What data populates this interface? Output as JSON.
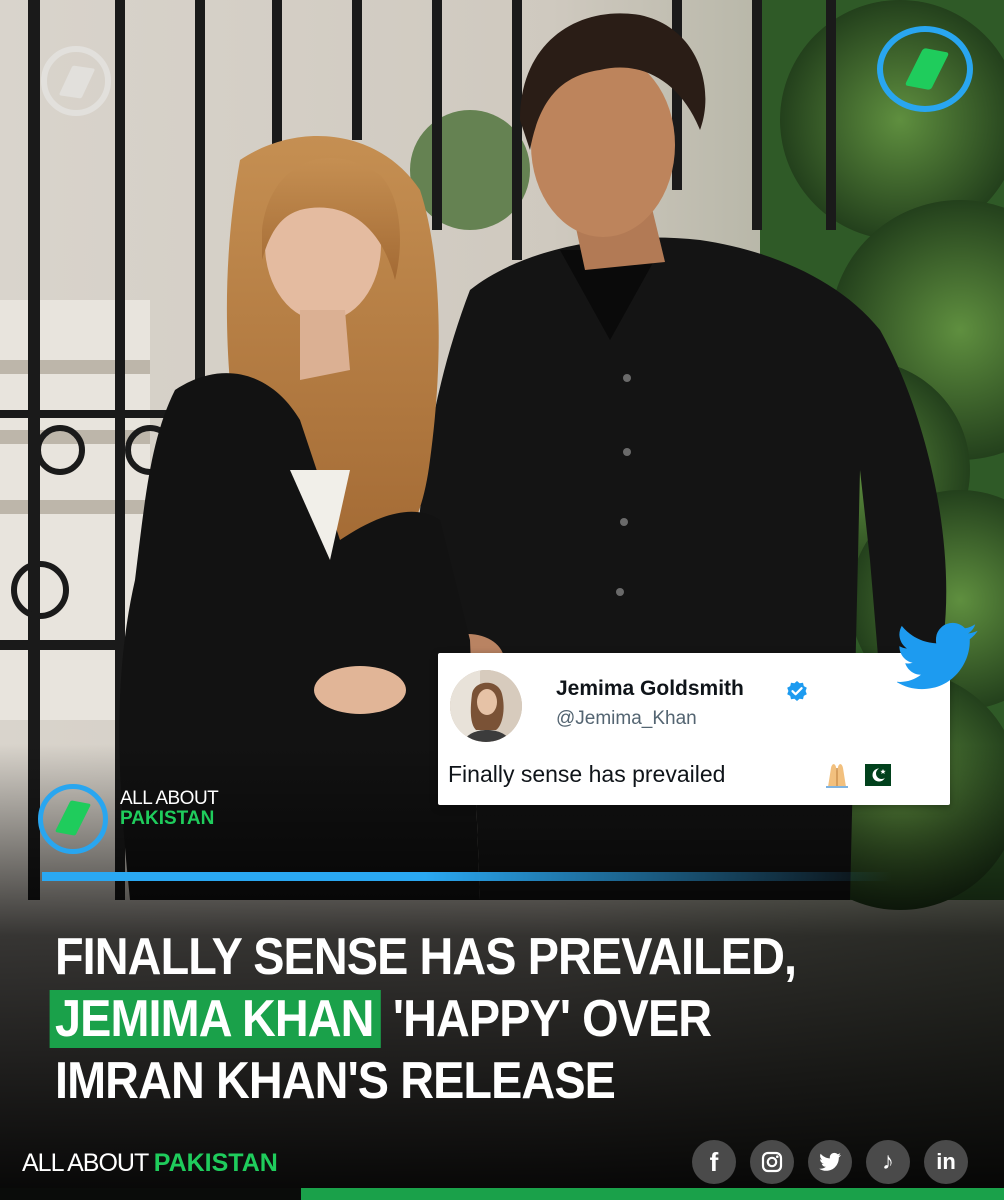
{
  "colors": {
    "accent_blue": "#29a6f0",
    "accent_green": "#1fcc5c",
    "highlight_green": "#1aa14a",
    "background": "#0a0c0a"
  },
  "tweet": {
    "name": "Jemima Goldsmith",
    "handle": "@Jemima_Khan",
    "text": "Finally sense has prevailed",
    "emoji": [
      "folded-hands-emoji",
      "pakistan-flag-emoji"
    ],
    "verified_icon": "verified-badge-icon"
  },
  "brand_badge": {
    "line1": "ALL ABOUT",
    "line2": "PAKISTAN"
  },
  "headline": {
    "line1": "FINALLY SENSE HAS PREVAILED,",
    "line2_highlight": "JEMIMA KHAN",
    "line2_rest": " 'HAPPY' OVER",
    "line3": "IMRAN KHAN'S RELEASE"
  },
  "footer": {
    "brand_part1": "ALL ABOUT ",
    "brand_part2": "PAKISTAN",
    "socials": [
      {
        "icon": "facebook-icon",
        "glyph": "f"
      },
      {
        "icon": "instagram-icon",
        "glyph": ""
      },
      {
        "icon": "twitter-icon",
        "glyph": ""
      },
      {
        "icon": "tiktok-icon",
        "glyph": "♪"
      },
      {
        "icon": "linkedin-icon",
        "glyph": "in"
      }
    ]
  }
}
